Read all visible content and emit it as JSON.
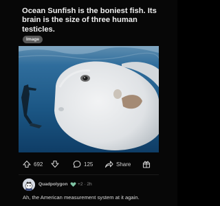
{
  "post": {
    "title": "Ocean Sunfish is the boniest fish. Its brain is the size of three human testicles.",
    "flair": "Image"
  },
  "actions": {
    "upvote_icon": "up-arrow-icon",
    "score": "692",
    "downvote_icon": "down-arrow-icon",
    "comment_icon": "comment-bubble-icon",
    "comment_count": "125",
    "share_icon": "share-arrow-icon",
    "share_label": "Share",
    "award_icon": "award-box-icon"
  },
  "comment": {
    "author": "Quadpolygon",
    "karma_icon": "heart-badge-icon",
    "meta": "+2 · 2h",
    "body": "Ah, the American measurement system at it again."
  },
  "colors": {
    "background": "#070707",
    "water": "#1f5a86",
    "fish": "#e6e8ea"
  }
}
